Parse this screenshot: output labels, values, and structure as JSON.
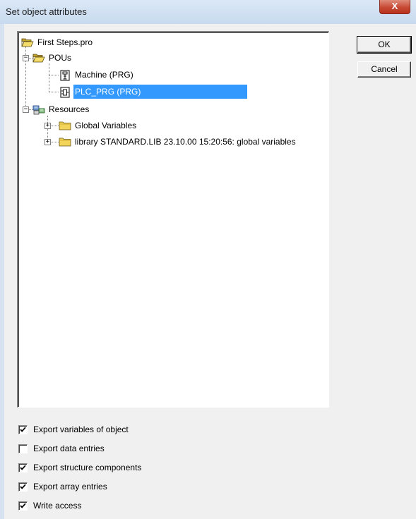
{
  "window": {
    "title": "Set object attributes",
    "close_glyph": "X"
  },
  "buttons": {
    "ok": "OK",
    "cancel": "Cancel"
  },
  "tree": {
    "root": {
      "label": "First Steps.pro",
      "icon": "open-folder-icon"
    },
    "pous": {
      "label": "POUs",
      "icon": "open-folder-icon",
      "toggle": "−"
    },
    "machine": {
      "label": "Machine (PRG)",
      "icon": "sfc-program-icon"
    },
    "plc_prg": {
      "label": "PLC_PRG (PRG)",
      "icon": "fbd-program-icon",
      "selected": true
    },
    "resources": {
      "label": "Resources",
      "icon": "resources-icon",
      "toggle": "−"
    },
    "global_vars": {
      "label": "Global Variables",
      "icon": "folder-icon",
      "toggle": "+"
    },
    "library": {
      "label": "library STANDARD.LIB 23.10.00 15:20:56: global variables",
      "icon": "folder-icon",
      "toggle": "+"
    }
  },
  "options": [
    {
      "label": "Export variables of object",
      "checked": true
    },
    {
      "label": "Export data entries",
      "checked": false
    },
    {
      "label": "Export structure components",
      "checked": true
    },
    {
      "label": "Export array entries",
      "checked": true
    },
    {
      "label": "Write access",
      "checked": true
    }
  ]
}
